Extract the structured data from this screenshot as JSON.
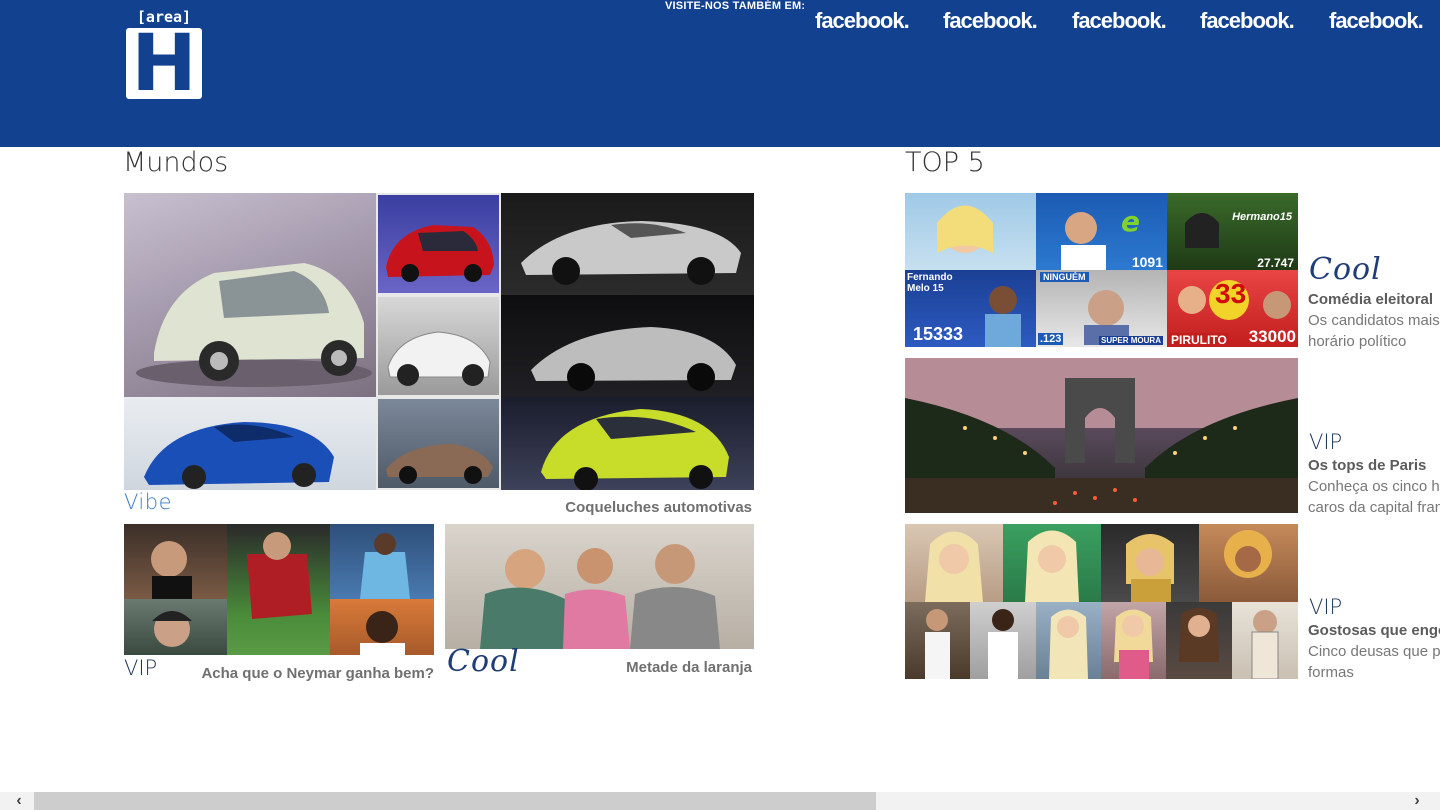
{
  "header": {
    "logo_top": "[area]",
    "logo_letter": "H",
    "visite_label": "VISITE-NOS TAMBÉM EM:",
    "social_links": [
      "facebook.",
      "facebook.",
      "facebook.",
      "facebook.",
      "facebook."
    ],
    "bg_color": "#11418f"
  },
  "sections": {
    "mundos_title": "Mundos",
    "top5_title": "TOP 5"
  },
  "mundos": {
    "feature": {
      "category": "Vibe",
      "title": "Coqueluches automotivas"
    },
    "card_vip": {
      "category": "VIP",
      "title": "Acha que o Neymar ganha bem?"
    },
    "card_cool": {
      "category": "Cool",
      "title": "Metade da laranja"
    }
  },
  "top5": {
    "items": [
      {
        "category": "Cool",
        "title": "Comédia eleitoral",
        "desc1": "Os candidatos mais",
        "desc2": "horário político"
      },
      {
        "category": "VIP",
        "title": "Os tops de Paris",
        "desc1": "Conheça os cinco h",
        "desc2": "caros da capital fran"
      },
      {
        "category": "VIP",
        "title": "Gostosas que engo",
        "desc1": "Cinco deusas que p",
        "desc2": "formas"
      }
    ]
  },
  "collage_labels": {
    "n1": "1091",
    "n2": "27.747",
    "n3": "15333",
    "n4": "33",
    "n5": "33000",
    "tag_pirulito": "PIRULITO",
    "tag_ninguem": "NINGUÉM",
    "tag_super": "SUPER MOURA",
    "tag_hermano": "Hermano15",
    "tag_fernando": "Fernando Melo 15",
    "tag_123": ".123"
  },
  "scrollbar": {
    "left_arrow": "‹",
    "right_arrow": "›"
  }
}
